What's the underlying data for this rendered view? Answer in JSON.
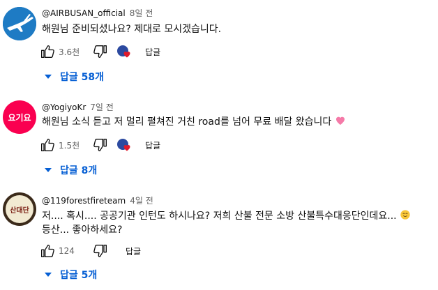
{
  "comments": [
    {
      "author": "@AIRBUSAN_official",
      "time": "8일 전",
      "text": "해원님 준비되셨나요? 제대로 모시겠습니다.",
      "likes": "3.6천",
      "reply_label": "답글",
      "replies": "답글 58개"
    },
    {
      "author": "@YogiyoKr",
      "time": "7일 전",
      "avatar_text": "요기요",
      "text": "해원님 소식 듣고 저 멀리 펼쳐진 거친 road를 넘어 무료 배달 왔습니다",
      "likes": "1.5천",
      "reply_label": "답글",
      "replies": "답글 8개"
    },
    {
      "author": "@119forestfireteam",
      "time": "4일 전",
      "avatar_text": "산대단",
      "text_line1": "저.... 혹시.... 공공기관 인턴도 하시나요? 저희 산불 전문 소방 산불특수대응단인데요...",
      "text_line2": "등산... 좋아하세요?",
      "likes": "124",
      "reply_label": "답글",
      "replies": "답글 5개"
    }
  ],
  "colors": {
    "link_blue": "#065fd4",
    "yogiyo_red": "#fa0050",
    "secondary_text": "#606060"
  }
}
